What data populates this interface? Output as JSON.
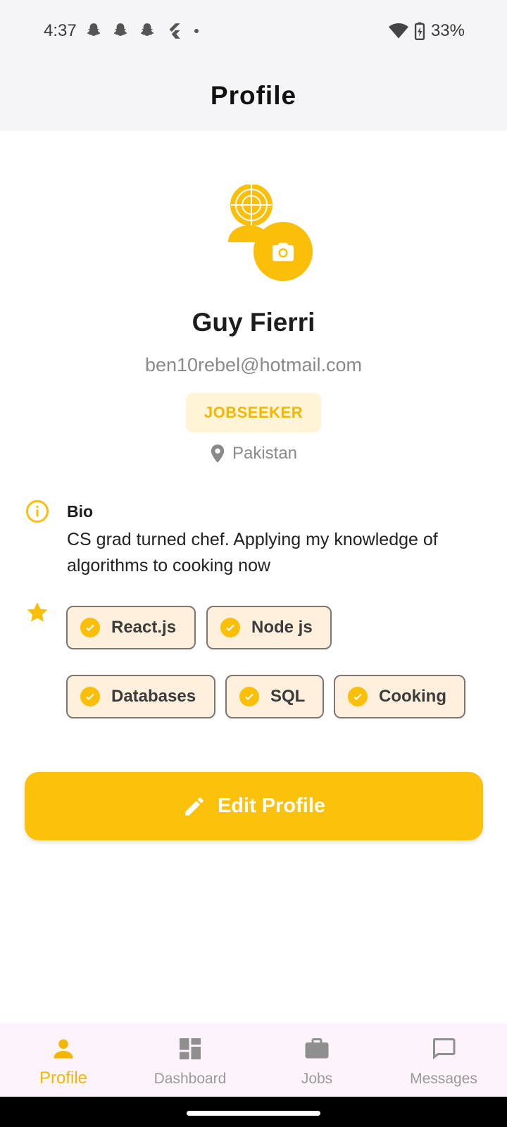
{
  "status_bar": {
    "time": "4:37",
    "battery": "33%",
    "left_icons": [
      "snapchat-icon",
      "snapchat-icon",
      "snapchat-icon",
      "flutter-icon",
      "dot-icon"
    ],
    "right_icons": [
      "wifi-icon",
      "battery-charging-icon"
    ]
  },
  "app_bar": {
    "title": "Profile"
  },
  "profile": {
    "name": "Guy Fierri",
    "email": "ben10rebel@hotmail.com",
    "role": "JOBSEEKER",
    "location": "Pakistan"
  },
  "bio": {
    "label": "Bio",
    "text": "CS grad turned chef. Applying my knowledge of algorithms to cooking now"
  },
  "skills": [
    {
      "label": "React.js"
    },
    {
      "label": "Node js"
    },
    {
      "label": "Databases"
    },
    {
      "label": "SQL"
    },
    {
      "label": "Cooking"
    }
  ],
  "edit_button": {
    "label": "Edit Profile"
  },
  "bottom_nav": {
    "items": [
      {
        "label": "Profile",
        "icon": "person-icon",
        "active": true
      },
      {
        "label": "Dashboard",
        "icon": "dashboard-icon",
        "active": false
      },
      {
        "label": "Jobs",
        "icon": "briefcase-icon",
        "active": false
      },
      {
        "label": "Messages",
        "icon": "chat-icon",
        "active": false
      }
    ]
  },
  "colors": {
    "accent": "#fcc10a",
    "chip_bg": "#fef0dc",
    "role_badge_bg": "#fff5d6",
    "nav_bg": "#fcf3fb"
  }
}
